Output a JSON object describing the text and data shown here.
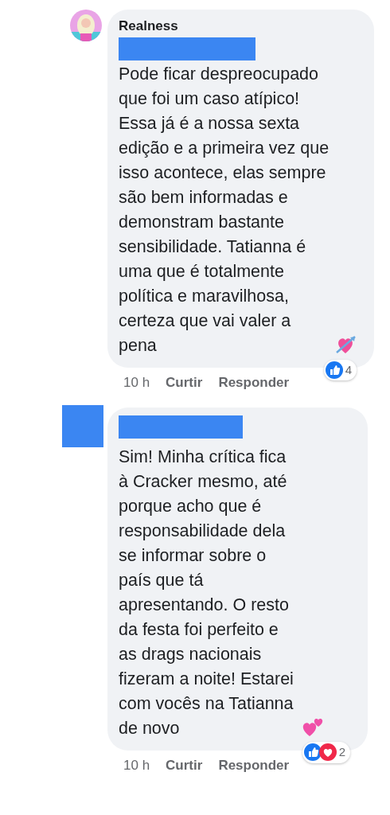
{
  "comments": [
    {
      "author": "Realness",
      "text": "Pode ficar despreocupado que foi um caso atípico! Essa já é a nossa sexta edição e a primeira vez que isso acontece, elas sempre são bem informadas e demonstram bastante sensibilidade. Tatianna é uma que é totalmente política e maravilhosa, certeza que vai valer a pena",
      "emoji": {
        "kind": "heart-arrow"
      },
      "time": "10 h",
      "actions": [
        "Curtir",
        "Responder"
      ],
      "reactions": {
        "icons": [
          {
            "kind": "like"
          }
        ],
        "count": "4"
      }
    },
    {
      "avatar": {
        "kind": "redaction"
      },
      "text": "Sim! Minha crítica fica à Cracker mesmo, até porque acho que é responsabilidade dela se informar sobre o país que tá apresentando. O resto da festa foi perfeito e as drags nacionais fizeram a noite! Estarei com vocês na Tatianna de novo",
      "emoji": {
        "kind": "two-hearts"
      },
      "time": "10 h",
      "actions": [
        "Curtir",
        "Responder"
      ],
      "reactions": {
        "icons": [
          {
            "kind": "like"
          },
          {
            "kind": "love"
          }
        ],
        "count": "2"
      }
    }
  ]
}
